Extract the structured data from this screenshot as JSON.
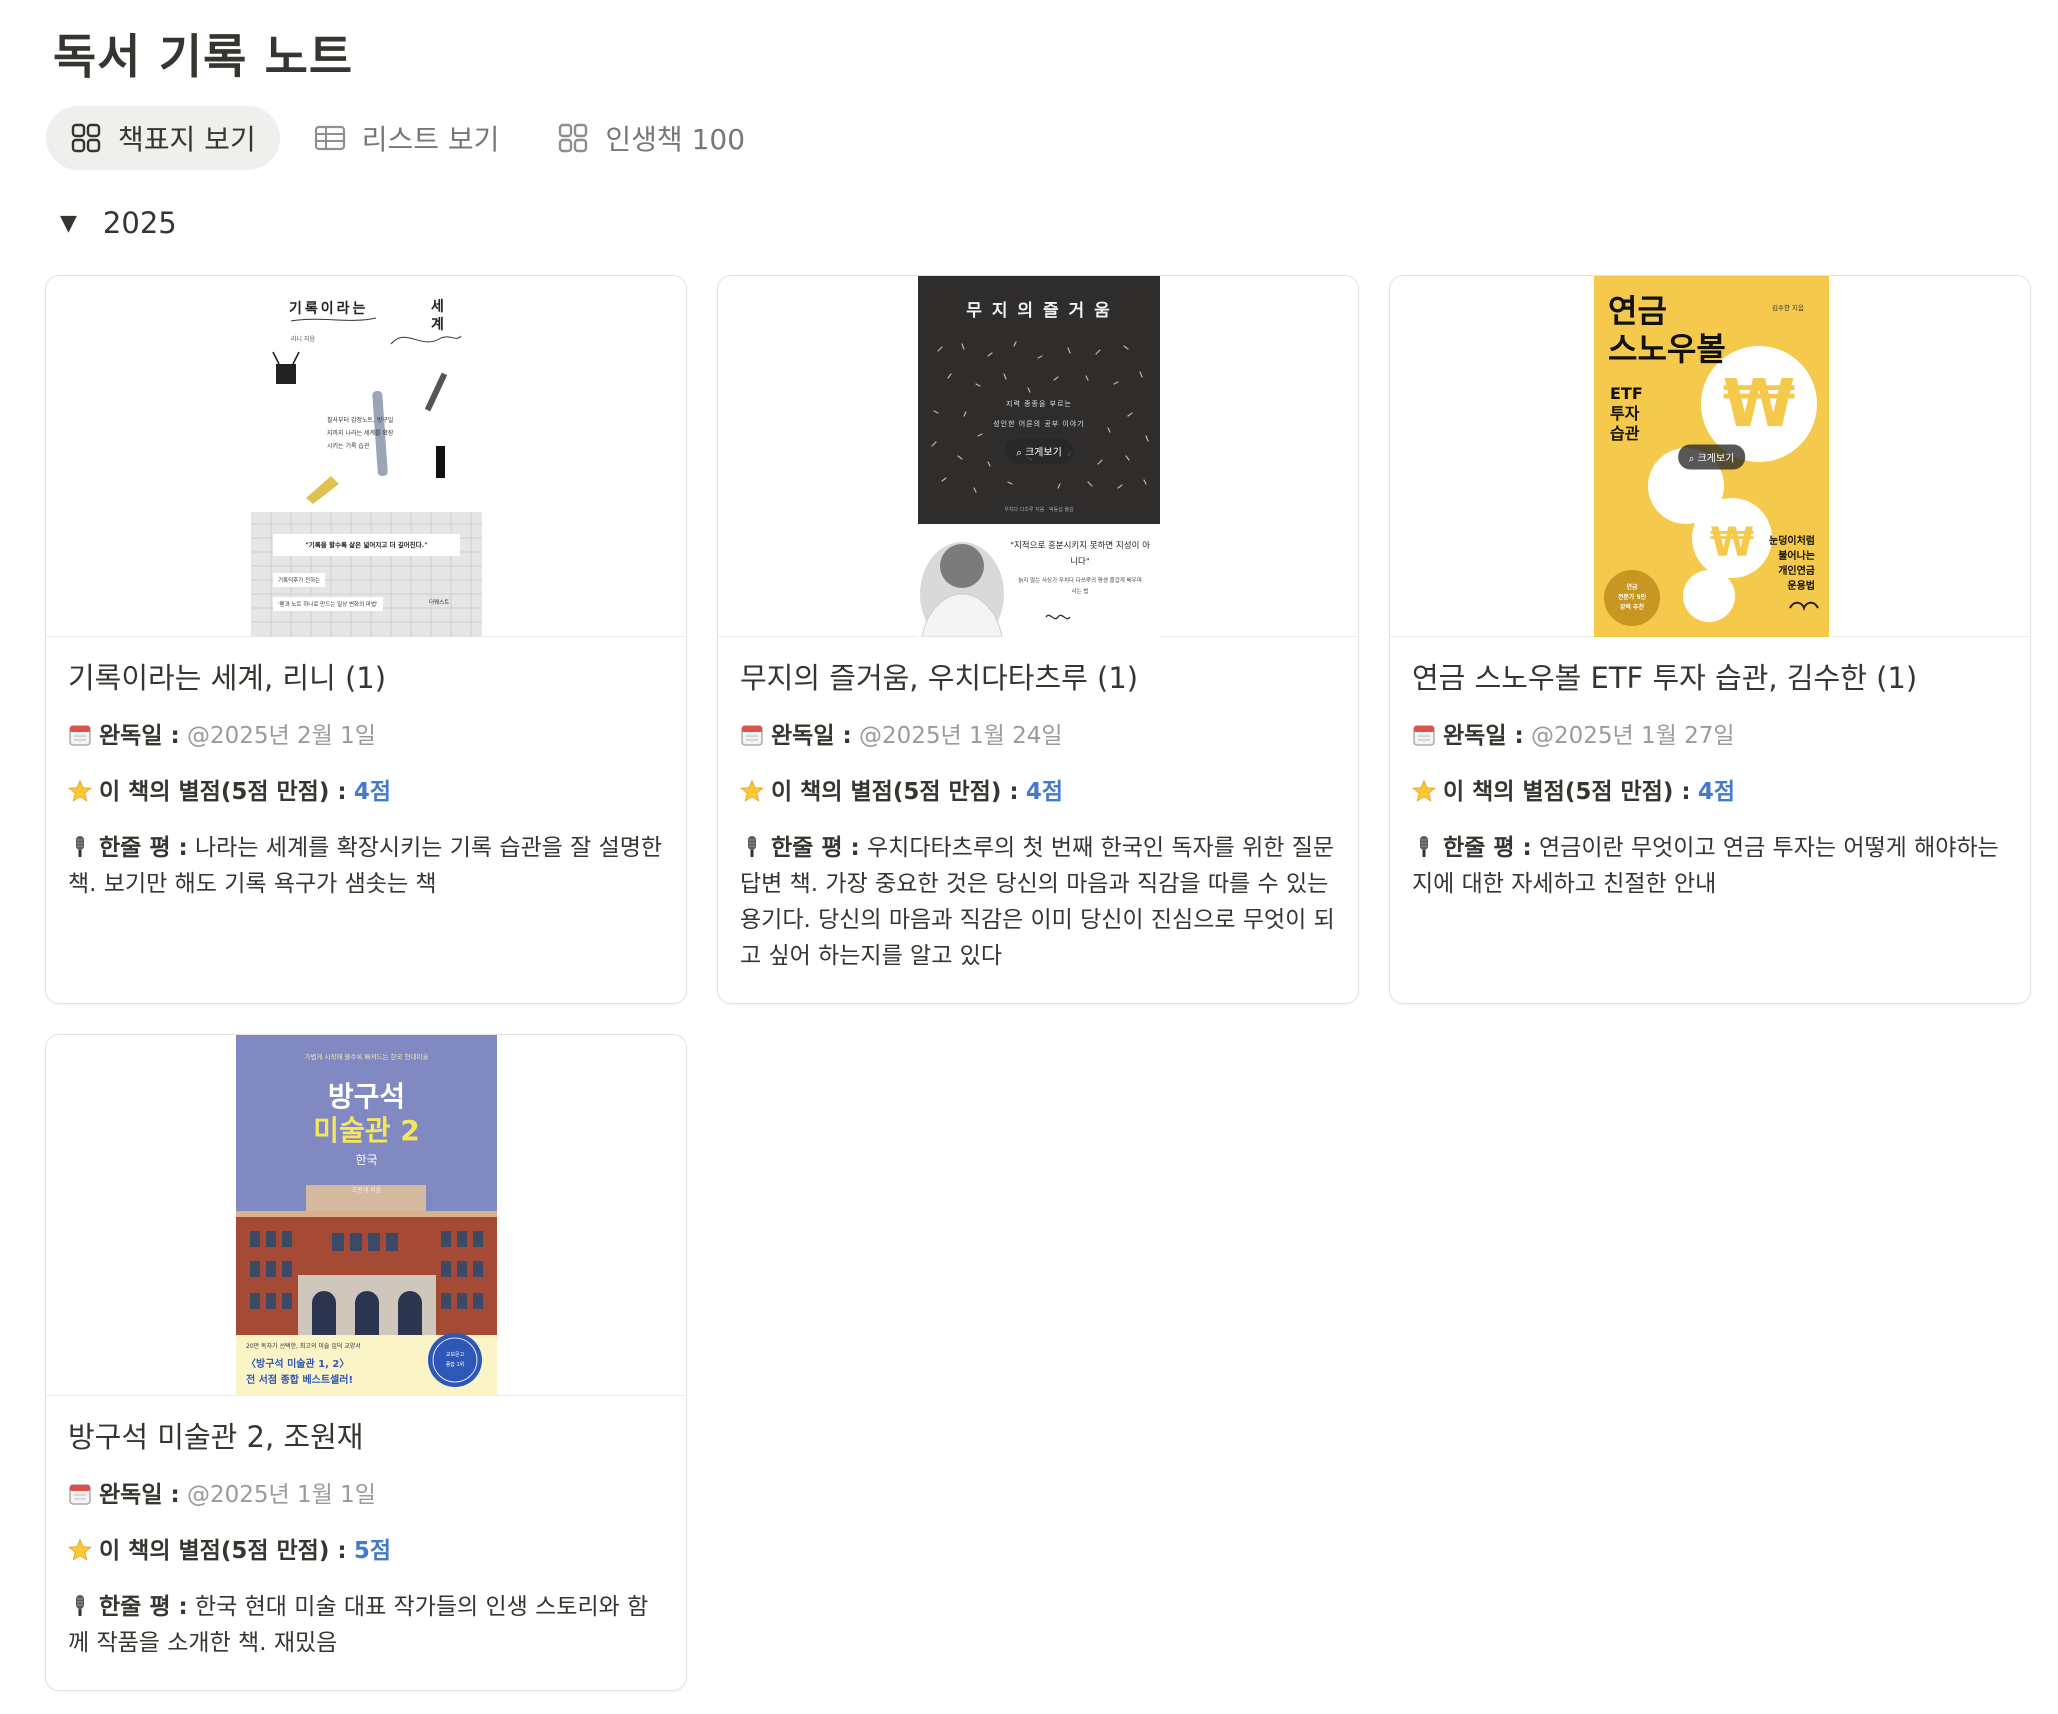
{
  "page": {
    "title": "독서 기록 노트"
  },
  "tabs": [
    {
      "label": "책표지 보기",
      "icon": "gallery-icon",
      "active": true
    },
    {
      "label": "리스트 보기",
      "icon": "table-icon",
      "active": false
    },
    {
      "label": "인생책 100",
      "icon": "gallery-icon",
      "active": false
    }
  ],
  "group": {
    "caret": "▼",
    "label": "2025"
  },
  "labels": {
    "date": "완독일 :",
    "rating": "이 책의 별점(5점 만점) :",
    "review": "한줄 평 :"
  },
  "cards": [
    {
      "title": "기록이라는 세계, 리니 (1)",
      "date": "@2025년 2월 1일",
      "rating": "4점",
      "review": "나라는 세계를 확장시키는 기록 습관을 잘 설명한 책. 보기만 해도 기록 욕구가 샘솟는 책",
      "cover": {
        "title_left": "기록이라는",
        "title_right": "세계",
        "author": "리니 지음",
        "blurb": "필사부터 감정노트, 방구일지까지 나라는 세계를 확장시키는 기록 습관",
        "quote": "\"기록을 할수록 삶은 넓어지고 더 깊어진다.\"",
        "tag": "기록덕후가 전하는",
        "subtitle": "'펜과 노트 하나로 만드는 일상 변화의 마법'",
        "publisher": "더퀘스트"
      }
    },
    {
      "title": "무지의 즐거움, 우치다타츠루 (1)",
      "date": "@2025년 1월 24일",
      "rating": "4점",
      "review": "우치다타츠루의 첫 번째 한국인 독자를 위한 질문 답변 책. 가장 중요한 것은 당신의 마음과 직감을 따를 수 있는 용기다. 당신의 마음과 직감은 이미 당신이 진심으로 무엇이 되고 싶어 하는지를 알고 있다",
      "cover": {
        "title": "무 지 의  즐 거 움",
        "line1": "지력 종종을 부르는",
        "line2": "성인한 어른의 공부 이야기",
        "zoom": "크게보기",
        "author": "우치다 다츠루 지음 · 박동섭 옮김",
        "quote": "\"지적으로 흥분시키지 못하면 지성이 아니다\"",
        "sub": "늙지 않는 사상가 우치다 다쓰루의 평생 즐겁게 배우며 사는 법"
      }
    },
    {
      "title": "연금 스노우볼 ETF 투자 습관, 김수한 (1)",
      "date": "@2025년 1월 27일",
      "rating": "4점",
      "review": "연금이란 무엇이고 연금 투자는 어떻게 해야하는지에 대한 자세하고 친절한 안내",
      "cover": {
        "title1": "연금",
        "title2": "스노우볼",
        "sub1": "ETF",
        "sub2": "투자",
        "sub3": "습관",
        "author": "김수한 지음",
        "zoom": "크게보기",
        "tag1": "눈덩이처럼",
        "tag2": "불어나는",
        "tag3": "개인연금",
        "tag4": "운용법",
        "badge1": "연금",
        "badge2": "전문가 5인",
        "badge3": "강력 추천"
      }
    },
    {
      "title": "방구석 미술관 2, 조원재",
      "date": "@2025년 1월 1일",
      "rating": "5점",
      "review": "한국 현대 미술 대표 작가들의 인생 스토리와 함께 작품을 소개한 책. 재밌음",
      "cover": {
        "top": "가볍게 시작해 볼수록 빠져드는 한국 현대미술",
        "title1": "방구석",
        "title2": "미술관 2",
        "sub": "한국",
        "author": "조원재 지음",
        "banner1": "20만 독자가 선택한, 최고의 미술 입덕 교양서",
        "banner2": "〈방구석 미술관 1, 2〉",
        "banner3": "전 서점 종합 베스트셀러!",
        "seal1": "교보문고",
        "seal2": "종합 1위"
      }
    }
  ]
}
